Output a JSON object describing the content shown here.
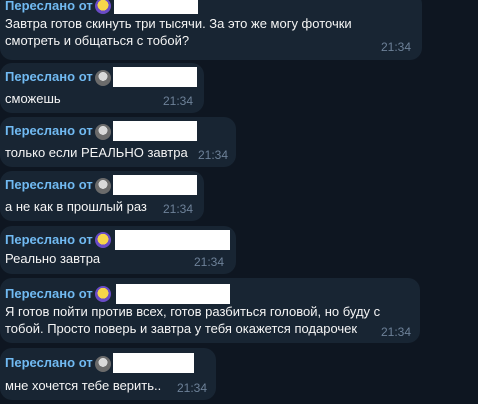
{
  "messages": [
    {
      "forward_label": "",
      "lines": [
        "Завтра готов скинуть три тысячи. За это же могу фоточки",
        "смотреть и общаться с тобой?"
      ],
      "time": "21:34",
      "avatar_icon": "emoji-avatar-icon"
    },
    {
      "forward_label": "Переслано от",
      "lines": [
        "сможешь"
      ],
      "time": "21:34",
      "avatar_icon": "user-photo-avatar-icon"
    },
    {
      "forward_label": "Переслано от",
      "lines": [
        "только если РЕАЛЬНО завтра"
      ],
      "time": "21:34",
      "avatar_icon": "user-photo-avatar-icon"
    },
    {
      "forward_label": "Переслано от",
      "lines": [
        "а не как в прошлый раз"
      ],
      "time": "21:34",
      "avatar_icon": "user-photo-avatar-icon"
    },
    {
      "forward_label": "Переслано от",
      "lines": [
        "Реально завтра"
      ],
      "time": "21:34",
      "avatar_icon": "emoji-avatar-icon"
    },
    {
      "forward_label": "Переслано от",
      "lines": [
        "Я готов пойти против  всех, готов разбиться головой, но буду с",
        "тобой. Просто поверь и завтра у тебя окажется подарочек"
      ],
      "time": "21:34",
      "avatar_icon": "emoji-avatar-icon"
    },
    {
      "forward_label": "Переслано от",
      "lines": [
        "мне хочется тебе верить.."
      ],
      "time": "21:34",
      "avatar_icon": "user-photo-avatar-icon"
    }
  ],
  "top_partial": {
    "forward_label": "Переслано от"
  }
}
